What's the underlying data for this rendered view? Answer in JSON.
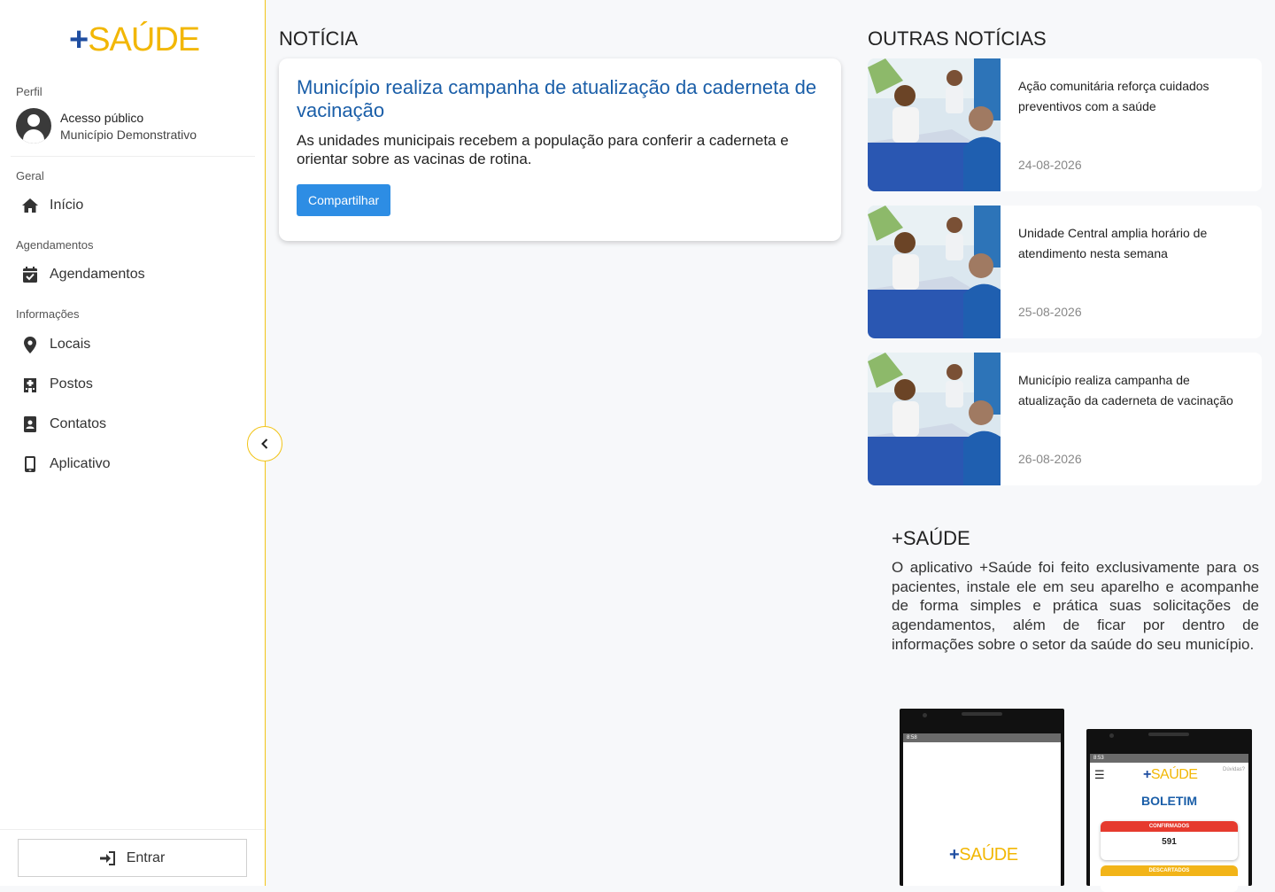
{
  "brand": {
    "plus": "+",
    "word": "SAÚDE"
  },
  "sidebar": {
    "profile_label": "Perfil",
    "profile_name": "Acesso público",
    "profile_city": "Município Demonstrativo",
    "sections": [
      {
        "label": "Geral",
        "items": [
          {
            "label": "Início",
            "icon": "home-icon"
          }
        ]
      },
      {
        "label": "Agendamentos",
        "items": [
          {
            "label": "Agendamentos",
            "icon": "calendar-check-icon"
          }
        ]
      },
      {
        "label": "Informações",
        "items": [
          {
            "label": "Locais",
            "icon": "map-pin-icon"
          },
          {
            "label": "Postos",
            "icon": "building-icon"
          },
          {
            "label": "Contatos",
            "icon": "contact-book-icon"
          },
          {
            "label": "Aplicativo",
            "icon": "mobile-phone-icon"
          }
        ]
      }
    ],
    "login_label": "Entrar",
    "collapse_icon": "chevron-left-icon"
  },
  "news": {
    "section_title": "NOTÍCIA",
    "headline": "Município realiza campanha de atualização da caderneta de vacinação",
    "summary": "As unidades municipais recebem a população para conferir a caderneta e orientar sobre as vacinas de rotina.",
    "share_label": "Compartilhar"
  },
  "other_news": {
    "section_title": "OUTRAS NOTÍCIAS",
    "items": [
      {
        "title": "Ação comunitária reforça cuidados preventivos com a saúde",
        "date": "24-08-2026"
      },
      {
        "title": "Unidade Central amplia horário de atendimento nesta semana",
        "date": "25-08-2026"
      },
      {
        "title": "Município realiza campanha de atualização da caderneta de vacinação",
        "date": "26-08-2026"
      }
    ]
  },
  "app_info": {
    "title": "+SAÚDE",
    "description": "O aplicativo +Saúde foi feito exclusivamente para os pacientes, instale ele em seu aparelho e acompanhe de forma simples e prática suas solicitações de agendamentos, além de ficar por dentro de informações sobre o setor da saúde do seu município.",
    "phone1": {
      "time": "8:58"
    },
    "phone2": {
      "time": "8:53",
      "help": "Dúvidas?",
      "heading": "BOLETIM",
      "confirmed_label": "CONFIRMADOS",
      "confirmed_value": "591",
      "discarded_label": "DESCARTADOS"
    }
  },
  "colors": {
    "brand_blue": "#1f4ea1",
    "brand_yellow": "#f2b705",
    "link_blue": "#1a5ea8",
    "button_blue": "#2d8de4"
  }
}
